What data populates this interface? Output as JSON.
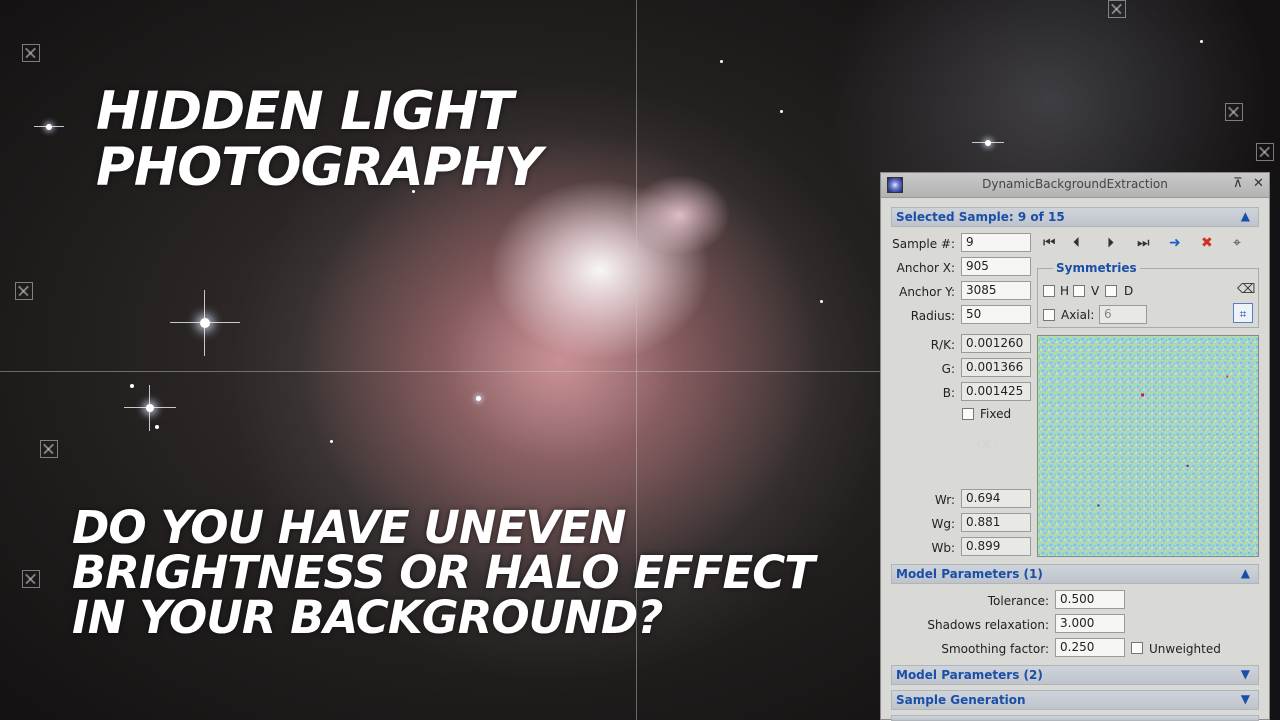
{
  "overlay": {
    "title_line1": "HIDDEN LIGHT",
    "title_line2": "PHOTOGRAPHY",
    "question_line1": "DO YOU HAVE UNEVEN",
    "question_line2": "BRIGHTNESS OR HALO EFFECT",
    "question_line3": "IN YOUR BACKGROUND?"
  },
  "window": {
    "title": "DynamicBackgroundExtraction",
    "pin_icon": "pin-icon",
    "close_icon": "close-icon"
  },
  "selected_sample": {
    "header": "Selected Sample: 9 of 15",
    "sample_label": "Sample #:",
    "sample_value": "9",
    "anchor_x_label": "Anchor X:",
    "anchor_x_value": "905",
    "anchor_y_label": "Anchor Y:",
    "anchor_y_value": "3085",
    "radius_label": "Radius:",
    "radius_value": "50",
    "rk_label": "R/K:",
    "rk_value": "0.001260",
    "g_label": "G:",
    "g_value": "0.001366",
    "b_label": "B:",
    "b_value": "0.001425",
    "fixed_label": "Fixed",
    "wr_label": "Wr:",
    "wr_value": "0.694",
    "wg_label": "Wg:",
    "wg_value": "0.881",
    "wb_label": "Wb:",
    "wb_value": "0.899"
  },
  "symmetries": {
    "title": "Symmetries",
    "h_label": "H",
    "v_label": "V",
    "d_label": "D",
    "axial_label": "Axial:",
    "axial_value": "6"
  },
  "model_parameters_1": {
    "header": "Model Parameters (1)",
    "tolerance_label": "Tolerance:",
    "tolerance_value": "0.500",
    "shadows_label": "Shadows relaxation:",
    "shadows_value": "3.000",
    "smoothing_label": "Smoothing factor:",
    "smoothing_value": "0.250",
    "unweighted_label": "Unweighted"
  },
  "model_parameters_2": {
    "header": "Model Parameters (2)"
  },
  "sample_generation": {
    "header": "Sample Generation"
  },
  "colors": {
    "section_text": "#1a4fa8",
    "nav_blue": "#1a5fd0",
    "delete_red": "#d03020"
  }
}
